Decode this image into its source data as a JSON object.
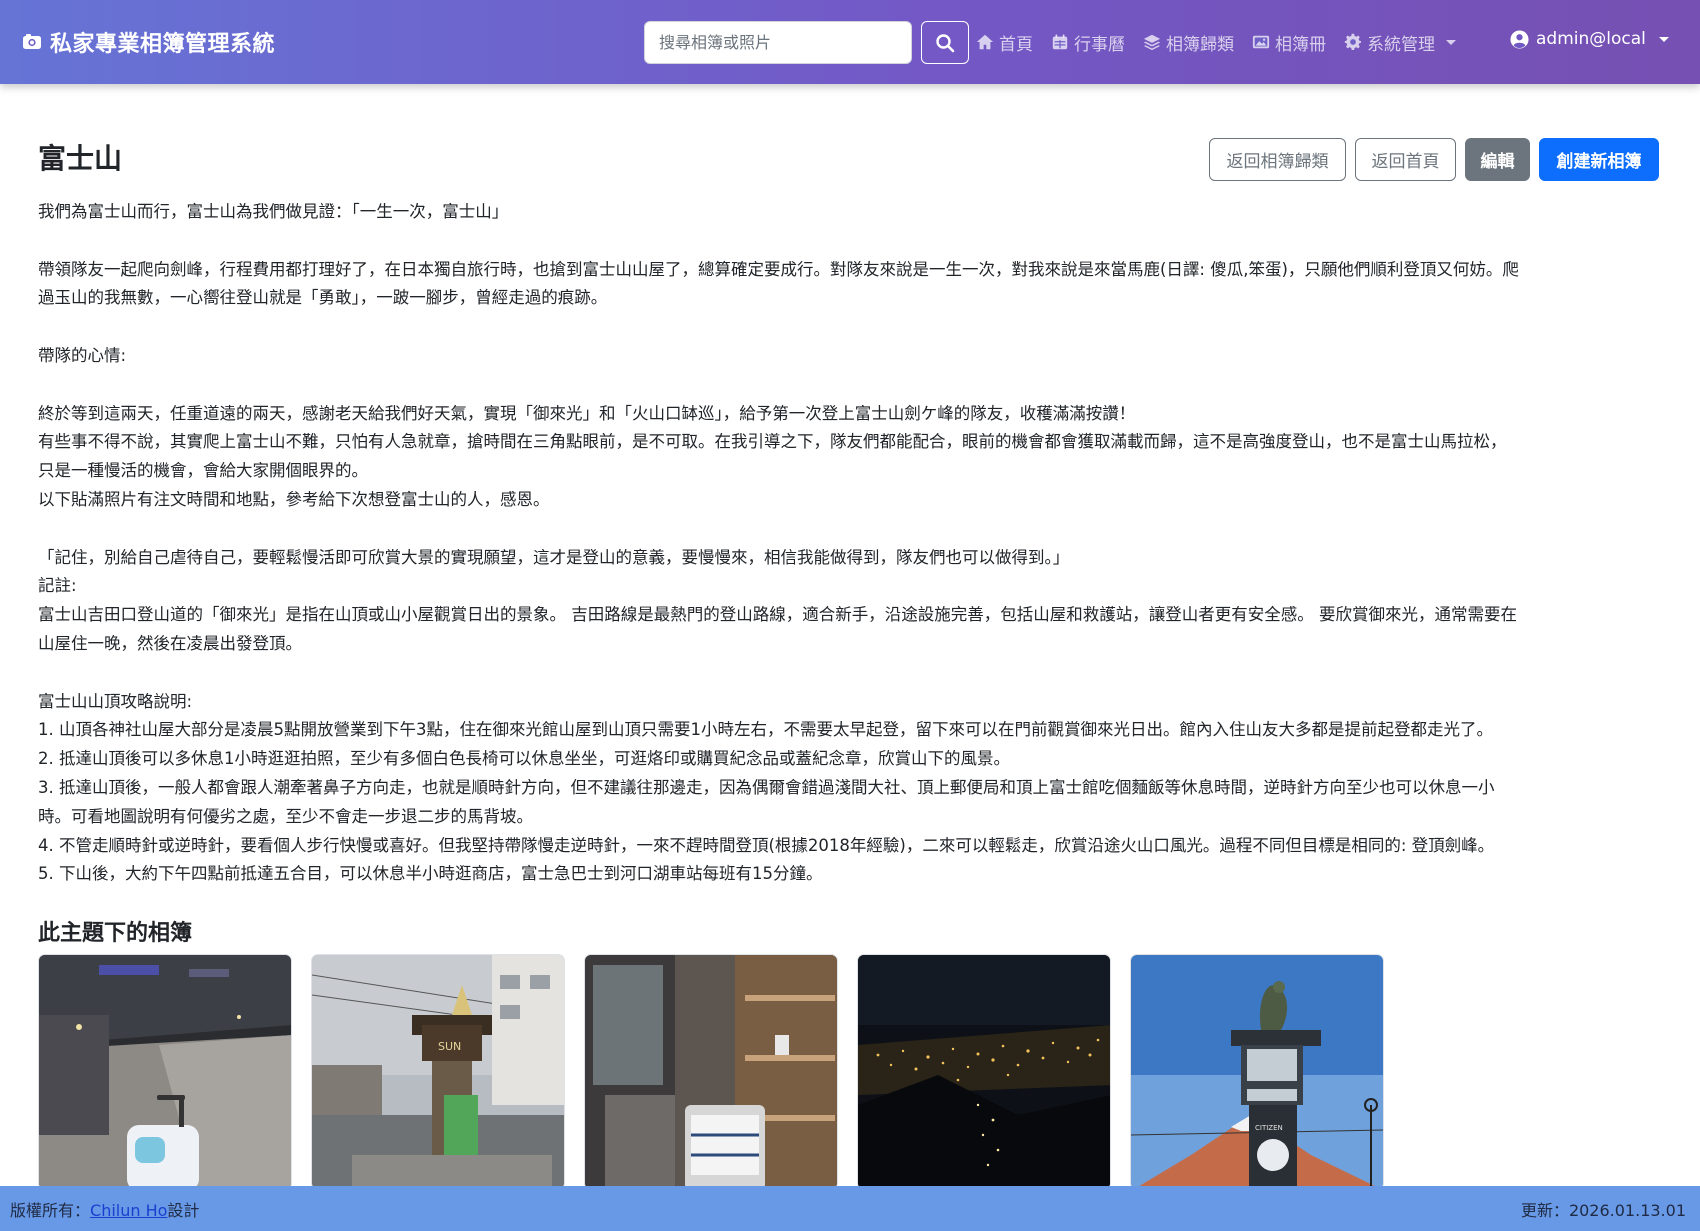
{
  "navbar": {
    "brand": "私家專業相簿管理系統",
    "search_placeholder": "搜尋相簿或照片",
    "links": [
      "首頁",
      "行事曆",
      "相簿歸類",
      "相簿冊",
      "系統管理"
    ],
    "user": "admin@local"
  },
  "main": {
    "title": "富士山",
    "buttons": {
      "back_category": "返回相簿歸類",
      "back_home": "返回首頁",
      "edit": "編輯",
      "create": "創建新相簿"
    },
    "description": [
      "我們為富士山而行，富士山為我們做見證：「一生一次，富士山」",
      "",
      "帶領隊友一起爬向劍峰，行程費用都打理好了，在日本獨自旅行時，也搶到富士山山屋了，總算確定要成行。對隊友來說是一生一次，對我來說是來當馬鹿(日譯: 傻瓜,笨蛋)，只願他們順利登頂又何妨。爬",
      "過玉山的我無數，一心嚮往登山就是「勇敢」，一跛一腳步，曾經走過的痕跡。",
      "",
      "帶隊的心情:",
      "",
      "終於等到這兩天，任重道遠的兩天，感謝老天給我們好天氣，實現「御來光」和「火山口缽巡」，給予第一次登上富士山劍ケ峰的隊友，收穫滿滿按讚！",
      "有些事不得不說，其實爬上富士山不難，只怕有人急就章，搶時間在三角點眼前，是不可取。在我引導之下，隊友們都能配合，眼前的機會都會獲取滿載而歸，這不是高強度登山，也不是富士山馬拉松，",
      "只是一種慢活的機會，會給大家開個眼界的。",
      "以下貼滿照片有注文時間和地點，參考給下次想登富士山的人，感恩。",
      "",
      "「記住，別給自己虐待自己，要輕鬆慢活即可欣賞大景的實現願望，這才是登山的意義，要慢慢來，相信我能做得到，隊友們也可以做得到。」",
      "記註:",
      "富士山吉田口登山道的「御來光」是指在山頂或山小屋觀賞日出的景象。 吉田路線是最熱門的登山路線，適合新手，沿途設施完善，包括山屋和救護站，讓登山者更有安全感。 要欣賞御來光，通常需要在",
      "山屋住一晚，然後在凌晨出發登頂。",
      "",
      "富士山山頂攻略說明:",
      "1. 山頂各神社山屋大部分是凌晨5點開放營業到下午3點，住在御來光館山屋到山頂只需要1小時左右，不需要太早起登，留下來可以在門前觀賞御來光日出。館內入住山友大多都是提前起登都走光了。",
      "2. 抵達山頂後可以多休息1小時逛逛拍照，至少有多個白色長椅可以休息坐坐，可逛烙印或購買紀念品或蓋紀念章，欣賞山下的風景。",
      "3. 抵達山頂後，一般人都會跟人潮牽著鼻子方向走，也就是順時針方向，但不建議往那邊走，因為偶爾會錯過淺間大社、頂上郵便局和頂上富士館吃個麵飯等休息時間，逆時針方向至少也可以休息一小",
      "時。可看地圖說明有何優劣之處，至少不會走一步退二步的馬背坡。",
      "4. 不管走順時針或逆時針，要看個人步行快慢或喜好。但我堅持帶隊慢走逆時針，一來不趕時間登頂(根據2018年經驗)，二來可以輕鬆走，欣賞沿途火山口風光。過程不同但目標是相同的: 登頂劍峰。",
      "5. 下山後，大約下午四點前抵達五合目，可以休息半小時逛商店，富士急巴士到河口湖車站每班有15分鐘。"
    ],
    "albums_title": "此主題下的相簿",
    "thumb_texts": {
      "sign": "SUN",
      "clock": "CITIZEN"
    }
  },
  "footer": {
    "copyright_prefix": "版權所有：",
    "author": "Chilun Ho",
    "copyright_suffix": "設計",
    "updated": "更新：2026.01.13.01"
  },
  "colors": {
    "navbar_start": "#6674d6",
    "navbar_end": "#7650b2",
    "primary": "#0d6efd",
    "secondary": "#6c757d",
    "footer": "#6899e6"
  },
  "icons": {
    "brand": "camera-icon",
    "search": "search-icon",
    "nav": [
      "home-icon",
      "calendar-icon",
      "layers-icon",
      "images-icon",
      "gear-icon"
    ],
    "user": "user-circle-icon"
  }
}
